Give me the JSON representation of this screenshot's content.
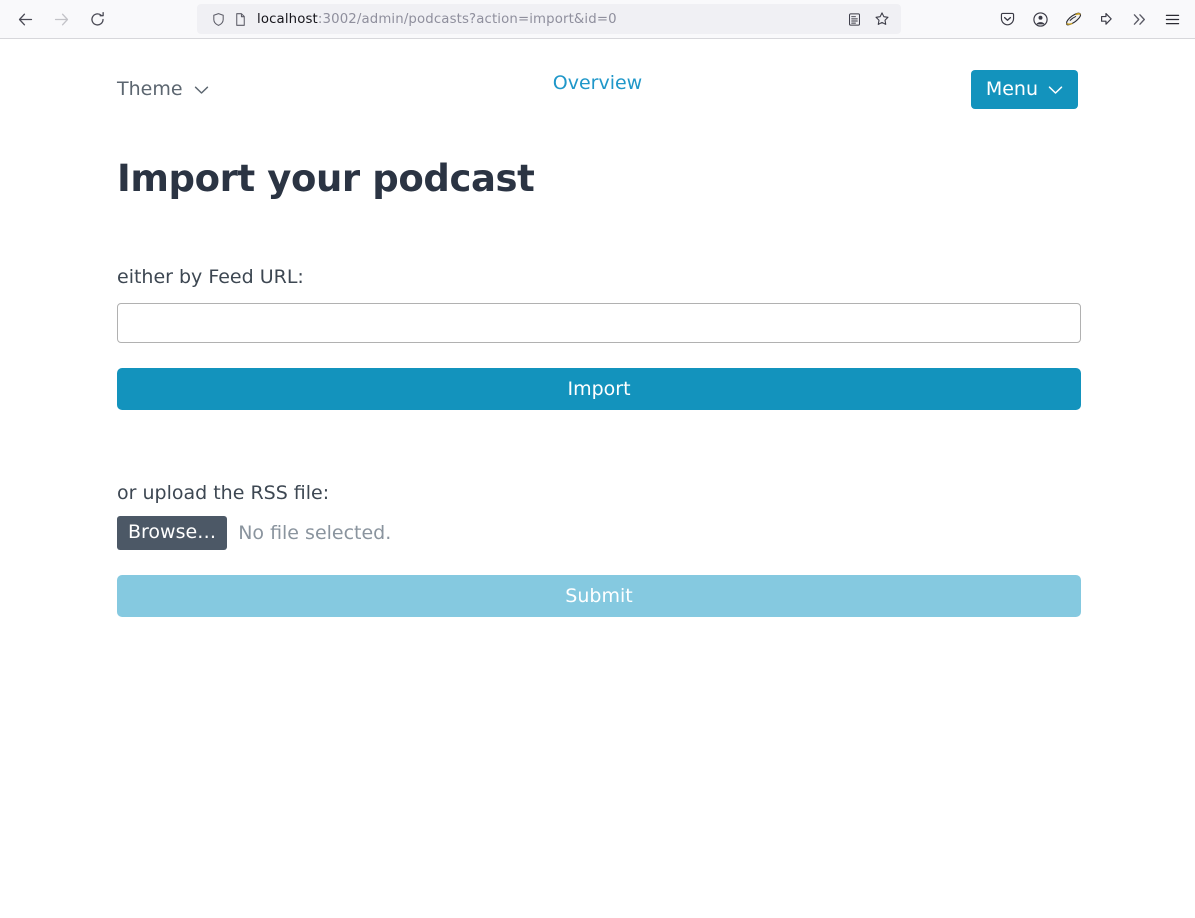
{
  "browser": {
    "nav": {
      "back_label": "Back",
      "forward_label": "Forward",
      "reload_label": "Reload"
    },
    "url": {
      "host": "localhost",
      "path": ":3002/admin/podcasts?action=import&id=0",
      "full": "localhost:3002/admin/podcasts?action=import&id=0"
    },
    "urlbar_icons": [
      "shield-icon",
      "page-icon"
    ],
    "urlbar_actions": [
      "reader-view-icon",
      "bookmark-star-icon"
    ],
    "toolbar_icons": [
      "pocket-icon",
      "account-icon",
      "extension-icon",
      "save-to-device-icon",
      "overflow-chevrons-icon",
      "hamburger-menu-icon"
    ]
  },
  "header": {
    "theme_label": "Theme",
    "overview_label": "Overview",
    "menu_label": "Menu"
  },
  "main": {
    "title": "Import your podcast",
    "feed_label": "either by Feed URL:",
    "feed_value": "",
    "feed_placeholder": "",
    "import_label": "Import",
    "upload_label": "or upload the RSS file:",
    "browse_label": "Browse…",
    "file_status": "No file selected.",
    "submit_label": "Submit"
  },
  "colors": {
    "accent": "#1393bd",
    "accent_light": "#85c9e0",
    "link": "#1f97c9",
    "title": "#2b3443",
    "browse_bg": "#4c5866",
    "muted_text": "#8a949e"
  }
}
